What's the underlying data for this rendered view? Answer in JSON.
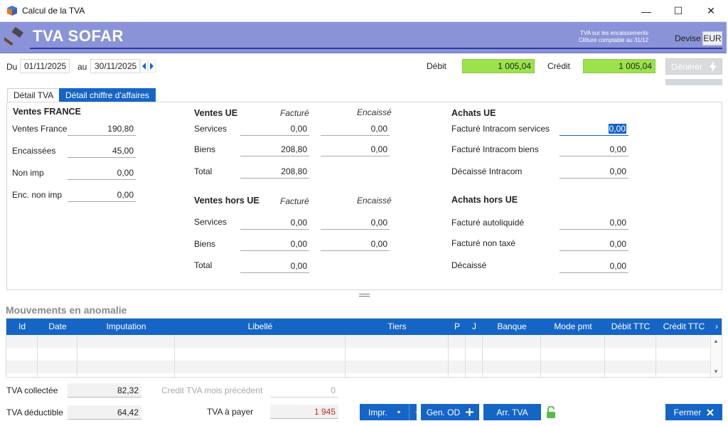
{
  "window": {
    "title": "Calcul de la TVA",
    "minimize": "—",
    "maximize": "☐",
    "close": "✕"
  },
  "banner": {
    "company": "TVA SOFAR",
    "tva_mode": "TVA sur les encaissements",
    "closing": "Clôture comptable au 31/12",
    "devise_label": "Devise",
    "devise_value": "EUR"
  },
  "period": {
    "from_label": "Du",
    "from": "01/11/2025",
    "to_label": "au",
    "to": "30/11/2025"
  },
  "totals": {
    "debit_label": "Débit",
    "debit": "1 005,04",
    "credit_label": "Crédit",
    "credit": "1 005,04"
  },
  "generate_label": "Générer",
  "tabs": [
    "Détail TVA",
    "Détail chiffre d'affaires"
  ],
  "ventes_france": {
    "title": "Ventes FRANCE",
    "rows": [
      {
        "label": "Ventes France",
        "value": "190,80"
      },
      {
        "label": "Encaissées",
        "value": "45,00"
      },
      {
        "label": "Non imp",
        "value": "0,00"
      },
      {
        "label": "Enc. non imp",
        "value": "0,00"
      }
    ]
  },
  "ventes_ue": {
    "title": "Ventes UE",
    "col1": "Facturé",
    "col2": "Encaissé",
    "rows": [
      {
        "label": "Services",
        "facture": "0,00",
        "encaisse": "0,00"
      },
      {
        "label": "Biens",
        "facture": "208,80",
        "encaisse": "0,00"
      },
      {
        "label": "Total",
        "facture": "208,80"
      }
    ]
  },
  "ventes_hors_ue": {
    "title": "Ventes hors UE",
    "col1": "Facturé",
    "col2": "Encaissé",
    "rows": [
      {
        "label": "Services",
        "facture": "0,00",
        "encaisse": "0,00"
      },
      {
        "label": "Biens",
        "facture": "0,00",
        "encaisse": "0,00"
      },
      {
        "label": "Total",
        "facture": "0,00"
      }
    ]
  },
  "achats_ue": {
    "title": "Achats UE",
    "rows": [
      {
        "label": "Facturé Intracom services",
        "value": "0,00"
      },
      {
        "label": "Facturé Intracom biens",
        "value": "0,00"
      },
      {
        "label": "Décaissé Intracom",
        "value": "0,00"
      }
    ]
  },
  "achats_hors_ue": {
    "title": "Achats hors UE",
    "rows": [
      {
        "label": "Facturé autoliquidé",
        "value": "0,00"
      },
      {
        "label": "Facturé non taxé",
        "value": "0,00"
      },
      {
        "label": "Décaissé",
        "value": "0,00"
      }
    ]
  },
  "anomalies": {
    "title": "Mouvements en anomalie",
    "columns": [
      "Id",
      "Date",
      "Imputation",
      "Libellé",
      "Tiers",
      "P",
      "J",
      "Banque",
      "Mode pmt",
      "Débit TTC",
      "Crédit TTC"
    ]
  },
  "summary": {
    "collectee_label": "TVA collectée",
    "collectee": "82,32",
    "deductible_label": "TVA déductible",
    "deductible": "64,42",
    "credit_prec_label": "Credit TVA mois précédent",
    "credit_prec": "0",
    "a_payer_label": "TVA à payer",
    "a_payer": "1 945"
  },
  "buttons": {
    "impr": "Impr.",
    "gen_od": "Gen. OD",
    "arr_tva": "Arr. TVA",
    "fermer": "Fermer"
  },
  "colors": {
    "accent": "#1565c6",
    "banner": "#8b93d8",
    "green": "#9be24b",
    "due": "#c62828"
  }
}
